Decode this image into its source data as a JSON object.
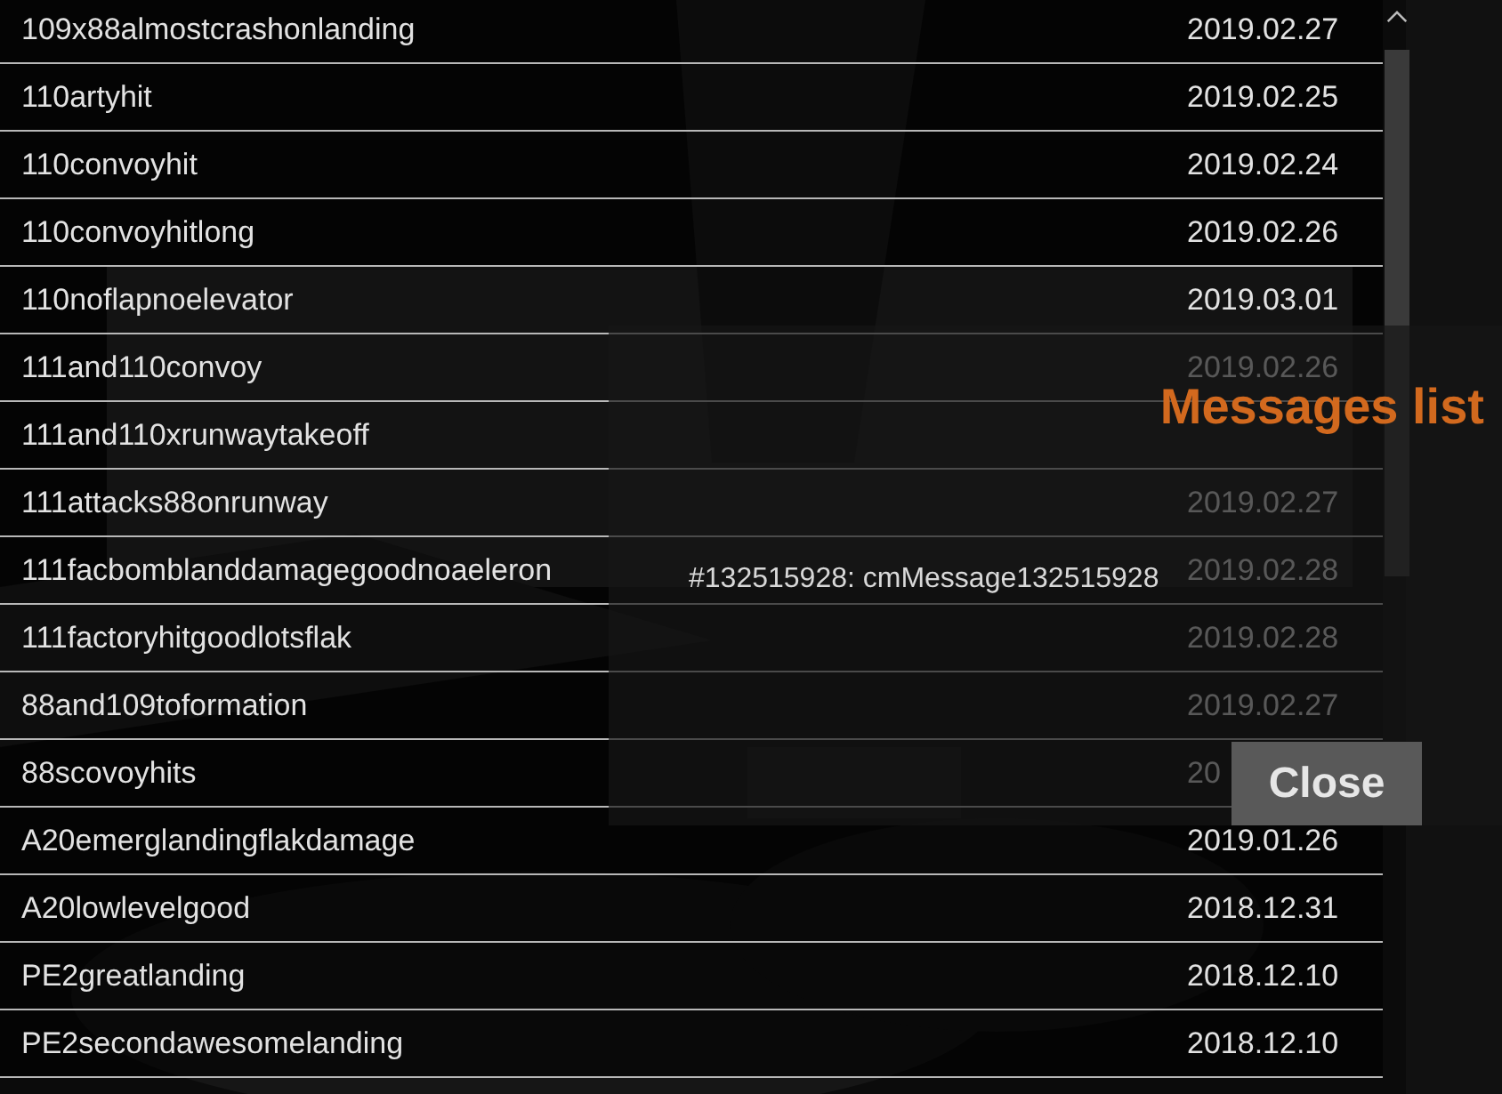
{
  "records": [
    {
      "name": "109x88almostcrashonlanding",
      "date": "2019.02.27"
    },
    {
      "name": "110artyhit",
      "date": "2019.02.25"
    },
    {
      "name": "110convoyhit",
      "date": "2019.02.24"
    },
    {
      "name": "110convoyhitlong",
      "date": "2019.02.26"
    },
    {
      "name": "110noflapnoelevator",
      "date": "2019.03.01"
    },
    {
      "name": "111and110convoy",
      "date": "2019.02.26"
    },
    {
      "name": "111and110xrunwaytakeoff"
    },
    {
      "name": "111attacks88onrunway",
      "date": "2019.02.27"
    },
    {
      "name": "111facbomblanddamagegoodnoaeleron",
      "date": "2019.02.28"
    },
    {
      "name": "111factoryhitgoodlotsflak",
      "date": "2019.02.28"
    },
    {
      "name": "88and109toformation",
      "date": "2019.02.27"
    },
    {
      "name": "88scovoyhits",
      "date": "20"
    },
    {
      "name": "A20emerglandingflakdamage",
      "date": "2019.01.26"
    },
    {
      "name": "A20lowlevelgood",
      "date": "2018.12.31"
    },
    {
      "name": "PE2greatlanding",
      "date": "2018.12.10"
    },
    {
      "name": "PE2secondawesomelanding",
      "date": "2018.12.10"
    }
  ],
  "dialog": {
    "title": "Messages list",
    "message": "#132515928: cmMessage132515928",
    "button": "Close"
  }
}
